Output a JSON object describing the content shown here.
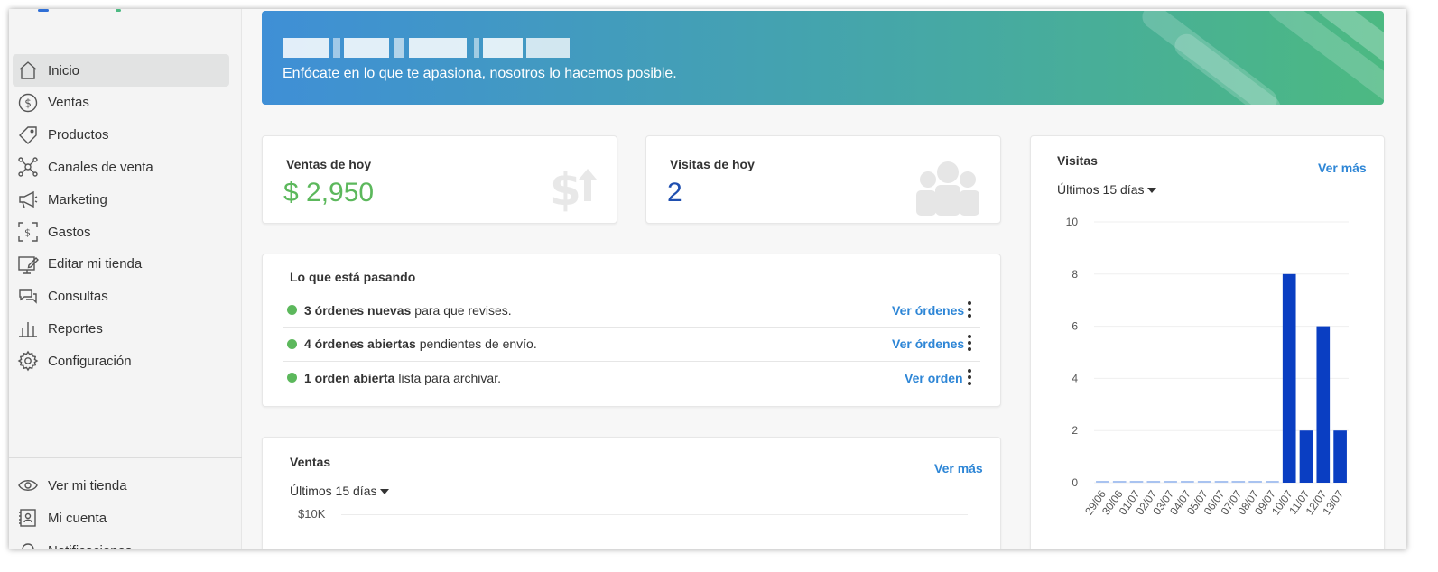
{
  "sidebar": {
    "items": [
      {
        "label": "Inicio",
        "icon": "home-icon"
      },
      {
        "label": "Ventas",
        "icon": "dollar-circle-icon"
      },
      {
        "label": "Productos",
        "icon": "tag-icon"
      },
      {
        "label": "Canales de venta",
        "icon": "network-icon"
      },
      {
        "label": "Marketing",
        "icon": "megaphone-icon"
      },
      {
        "label": "Gastos",
        "icon": "expenses-icon"
      },
      {
        "label": "Editar mi tienda",
        "icon": "edit-store-icon"
      },
      {
        "label": "Consultas",
        "icon": "chat-icon"
      },
      {
        "label": "Reportes",
        "icon": "bar-chart-icon"
      },
      {
        "label": "Configuración",
        "icon": "gear-icon"
      }
    ],
    "bottom_items": [
      {
        "label": "Ver mi tienda",
        "icon": "eye-icon"
      },
      {
        "label": "Mi cuenta",
        "icon": "account-icon"
      },
      {
        "label": "Notificaciones",
        "icon": "bell-icon"
      }
    ]
  },
  "banner": {
    "subtitle": "Enfócate en lo que te apasiona, nosotros lo hacemos posible."
  },
  "ventas_hoy": {
    "label": "Ventas de hoy",
    "value": "$ 2,950"
  },
  "visitas_hoy": {
    "label": "Visitas de hoy",
    "value": "2"
  },
  "activity": {
    "title": "Lo que está pasando",
    "rows": [
      {
        "bold": "3 órdenes nuevas",
        "text": "para que revises.",
        "link": "Ver órdenes"
      },
      {
        "bold": "4 órdenes abiertas",
        "text": "pendientes de envío.",
        "link": "Ver órdenes"
      },
      {
        "bold": "1 orden abierta",
        "text": "lista para archivar.",
        "link": "Ver orden"
      }
    ]
  },
  "ventas_card": {
    "title": "Ventas",
    "link": "Ver más",
    "range": "Últimos 15 días",
    "y_tick": "$10K"
  },
  "visitas_card": {
    "title": "Visitas",
    "link": "Ver más",
    "range": "Últimos 15 días"
  },
  "colors": {
    "accent": "#2e86d6",
    "bar": "#0a3ec2",
    "zero_bar": "#a9c3f0",
    "sales_green": "#5cb85c",
    "visits_blue": "#1f4fb0"
  },
  "chart_data": {
    "type": "bar",
    "title": "Visitas",
    "categories": [
      "29/06",
      "30/06",
      "01/07",
      "02/07",
      "03/07",
      "04/07",
      "05/07",
      "06/07",
      "07/07",
      "08/07",
      "09/07",
      "10/07",
      "11/07",
      "12/07",
      "13/07"
    ],
    "values": [
      0,
      0,
      0,
      0,
      0,
      0,
      0,
      0,
      0,
      0,
      0,
      8,
      2,
      6,
      2
    ],
    "ylim": [
      0,
      10
    ],
    "y_ticks": [
      0,
      2,
      4,
      6,
      8,
      10
    ],
    "grid": true
  }
}
